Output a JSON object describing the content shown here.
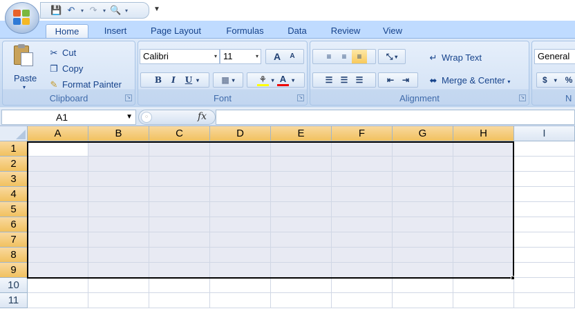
{
  "quick_access": {
    "save_icon": "save-icon",
    "undo_icon": "undo-icon",
    "redo_icon": "redo-icon",
    "print_preview_icon": "print-preview-icon",
    "customize_icon": "customize-dropdown-icon"
  },
  "tabs": [
    {
      "label": "Home",
      "active": true
    },
    {
      "label": "Insert"
    },
    {
      "label": "Page Layout"
    },
    {
      "label": "Formulas"
    },
    {
      "label": "Data"
    },
    {
      "label": "Review"
    },
    {
      "label": "View"
    }
  ],
  "clipboard": {
    "paste_label": "Paste",
    "cut_label": "Cut",
    "copy_label": "Copy",
    "format_painter_label": "Format Painter",
    "group_label": "Clipboard"
  },
  "font": {
    "font_name": "Calibri",
    "font_size": "11",
    "bold_label": "B",
    "italic_label": "I",
    "underline_label": "U",
    "font_color_label": "A",
    "grow_label": "A",
    "shrink_label": "A",
    "group_label": "Font"
  },
  "alignment": {
    "wrap_text_label": "Wrap Text",
    "merge_center_label": "Merge & Center",
    "group_label": "Alignment"
  },
  "number": {
    "format_value": "General",
    "currency_label": "$",
    "group_label_partial": "N"
  },
  "formula_bar": {
    "name_box_value": "A1",
    "fx_label": "fx",
    "formula_value": ""
  },
  "columns": [
    "A",
    "B",
    "C",
    "D",
    "E",
    "F",
    "G",
    "H",
    "I"
  ],
  "rows": [
    "1",
    "2",
    "3",
    "4",
    "5",
    "6",
    "7",
    "8",
    "9",
    "10",
    "11"
  ],
  "selection": {
    "range": "A1:H9",
    "active_cell": "A1"
  },
  "colors": {
    "ribbon_bg": "#c9dbf2",
    "header_selected": "#f1c15f",
    "selection_fill": "#e8eaf3",
    "tab_text": "#15428b"
  }
}
